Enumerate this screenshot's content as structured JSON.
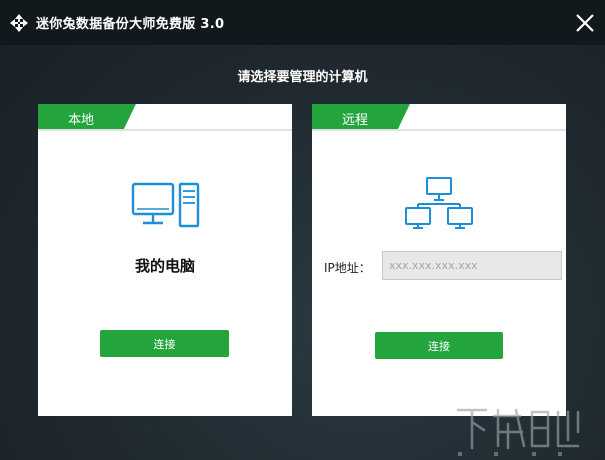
{
  "window": {
    "title": "迷你兔数据备份大师免费版 3.0",
    "close_icon": "close-icon",
    "logo_icon": "app-logo-icon"
  },
  "prompt": "请选择要管理的计算机",
  "local": {
    "tab_label": "本地",
    "icon": "computer-icon",
    "computer_name": "我的电脑",
    "connect_label": "连接"
  },
  "remote": {
    "tab_label": "远程",
    "icon": "network-icon",
    "ip_label": "IP地址：",
    "ip_placeholder": "xxx.xxx.xxx.xxx",
    "ip_value": "",
    "connect_label": "连接"
  },
  "colors": {
    "accent_green": "#24a43c",
    "icon_blue": "#1d8fd6",
    "titlebar": "#12191d"
  }
}
